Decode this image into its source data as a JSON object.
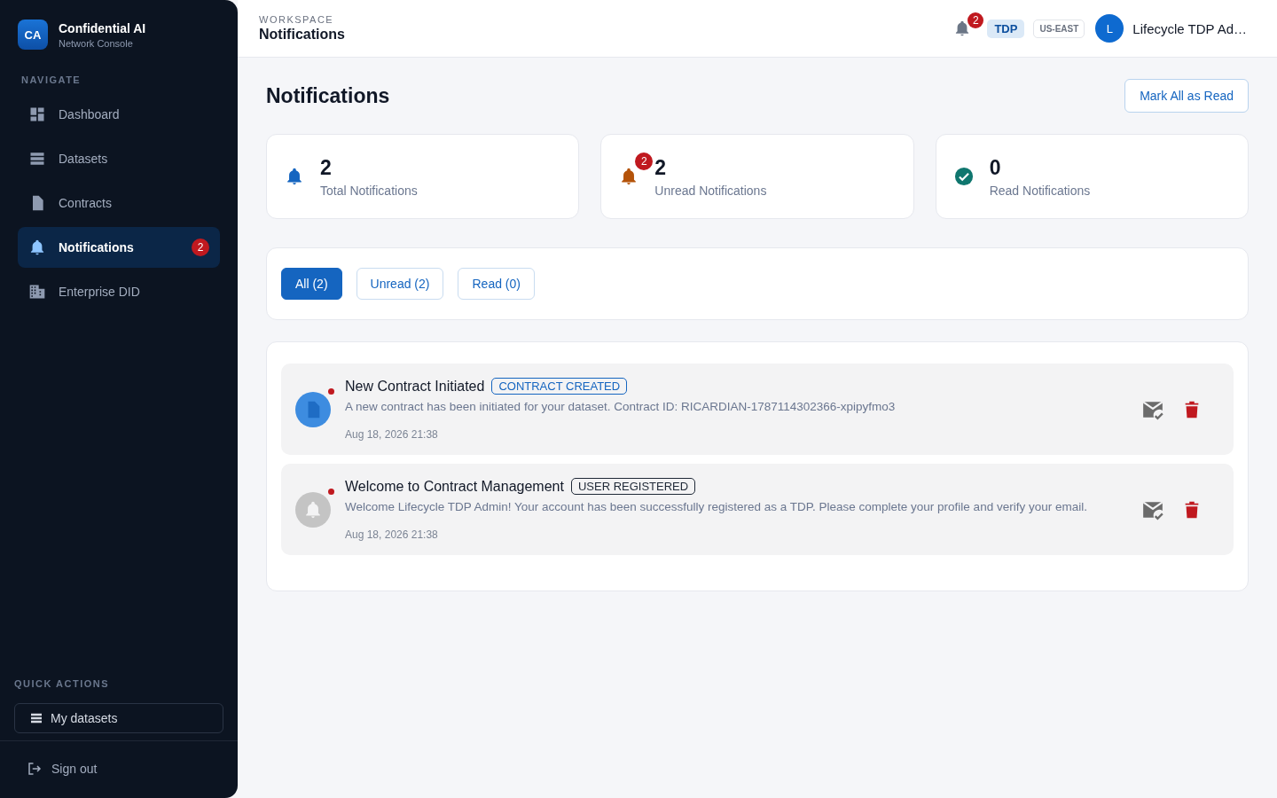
{
  "brand": {
    "logo": "CA",
    "name": "Confidential AI",
    "subtitle": "Network Console"
  },
  "sidebar": {
    "section_title": "NAVIGATE",
    "items": [
      {
        "label": "Dashboard",
        "selected": false
      },
      {
        "label": "Datasets",
        "selected": false
      },
      {
        "label": "Contracts",
        "selected": false
      },
      {
        "label": "Notifications",
        "selected": true,
        "badge": "2"
      },
      {
        "label": "Enterprise DID",
        "selected": false
      }
    ],
    "quick_actions_title": "QUICK ACTIONS",
    "quick_action": "My datasets",
    "sign_out": "Sign out"
  },
  "header": {
    "eyebrow": "WORKSPACE",
    "title": "Notifications",
    "bell_badge": "2",
    "role": "TDP",
    "region": "US-EAST",
    "avatar": "L",
    "user": "Lifecycle TDP Ad…"
  },
  "page": {
    "title": "Notifications",
    "mark_all": "Mark All as Read"
  },
  "stats": [
    {
      "kind": "bell",
      "color": "#1565c0",
      "value": "2",
      "label": "Total Notifications"
    },
    {
      "kind": "bell",
      "color": "#b45309",
      "value": "2",
      "label": "Unread Notifications",
      "badge": "2"
    },
    {
      "kind": "check",
      "color": "#0f766e",
      "value": "0",
      "label": "Read Notifications"
    }
  ],
  "filters": [
    {
      "label": "All (2)",
      "selected": true
    },
    {
      "label": "Unread (2)",
      "selected": false
    },
    {
      "label": "Read (0)",
      "selected": false
    }
  ],
  "notifications": [
    {
      "kind": "document",
      "unread": true,
      "title": "New Contract Initiated",
      "tag": "CONTRACT CREATED",
      "message": "A new contract has been initiated for your dataset. Contract ID: RICARDIAN-1787114302366-xpipyfmo3",
      "time": "Aug 18, 2026 21:38"
    },
    {
      "kind": "bell",
      "unread": true,
      "title": "Welcome to Contract Management",
      "tag": "USER REGISTERED",
      "message": "Welcome Lifecycle TDP Admin! Your account has been successfully registered as a TDP. Please complete your profile and verify your email.",
      "time": "Aug 18, 2026 21:38"
    }
  ]
}
